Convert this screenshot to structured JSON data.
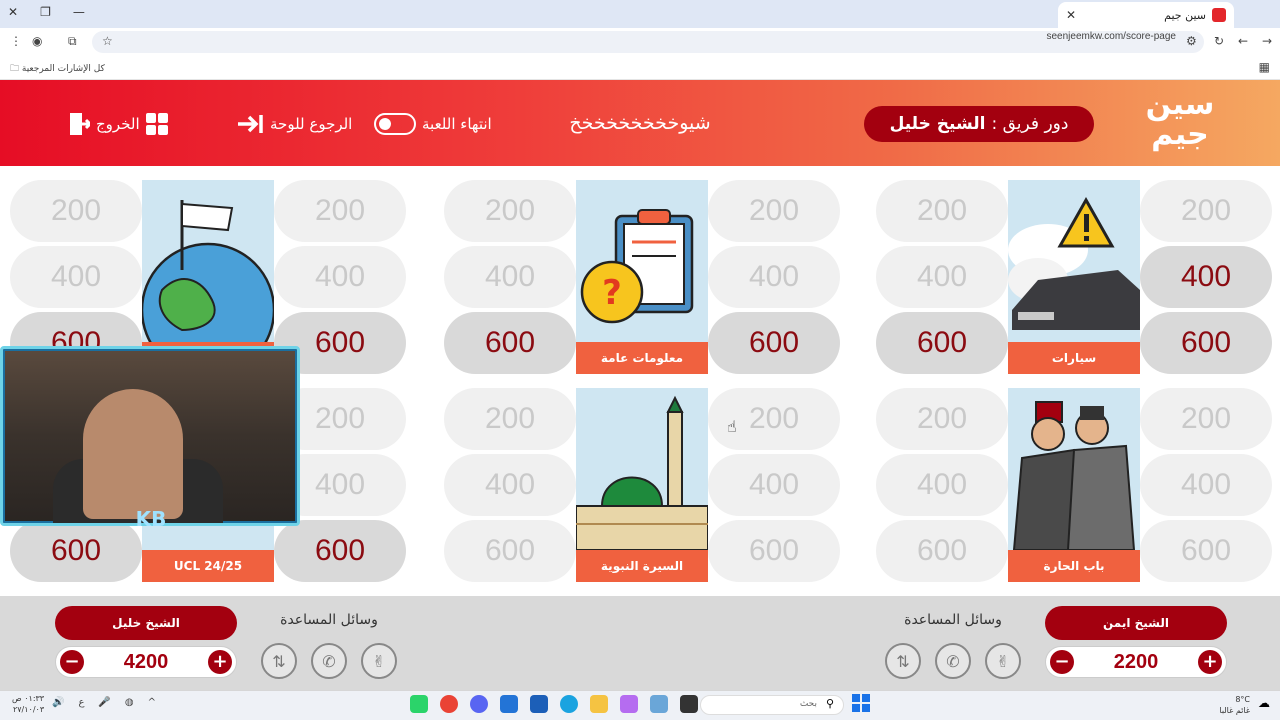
{
  "browser": {
    "tab_title": "سين جيم",
    "url": "seenjeemkw.com/score-page",
    "bookmarks_label": "كل الإشارات المرجعية"
  },
  "header": {
    "logo_line1": "سين",
    "logo_line2": "جيم",
    "turn_prefix": "دور فريق :",
    "turn_team": "الشيخ خليل",
    "game_title": "شيوخخخخخخخخخ",
    "end_game_label": "انتهاء اللعبة",
    "back_to_board_label": "الرجوع للوحة",
    "exit_label": "الخروج"
  },
  "board": {
    "categories": [
      {
        "label": "سيارات",
        "art": "car-warning"
      },
      {
        "label": "معلومات عامة",
        "art": "clipboard-question"
      },
      {
        "label": "UCL 24/25",
        "art": "globe-flag"
      },
      {
        "label": "باب الحارة",
        "art": "two-men"
      },
      {
        "label": "السيرة النبوية",
        "art": "mosque"
      },
      {
        "label": "",
        "art": "hidden"
      }
    ],
    "points": [
      "200",
      "400",
      "600"
    ],
    "used_tiles_note": "active tiles shown darker",
    "cursor": "pointer"
  },
  "teams": [
    {
      "name": "الشيخ ايمن",
      "score": "2200"
    },
    {
      "name": "الشيخ خليل",
      "score": "4200"
    }
  ],
  "aids_title": "وسائل المساعدة",
  "webcam_badge": "KB",
  "taskbar": {
    "time": "٠١:٣٣ ص",
    "date": "٢٧/١٠/٠٣",
    "search_placeholder": "بحث",
    "weather_temp": "8°C",
    "weather_desc": "غائم غالبا"
  },
  "colors": {
    "accent": "#a3000f",
    "label_orange": "#f0613f",
    "header_start": "#e60d25",
    "header_end": "#f5a861"
  }
}
